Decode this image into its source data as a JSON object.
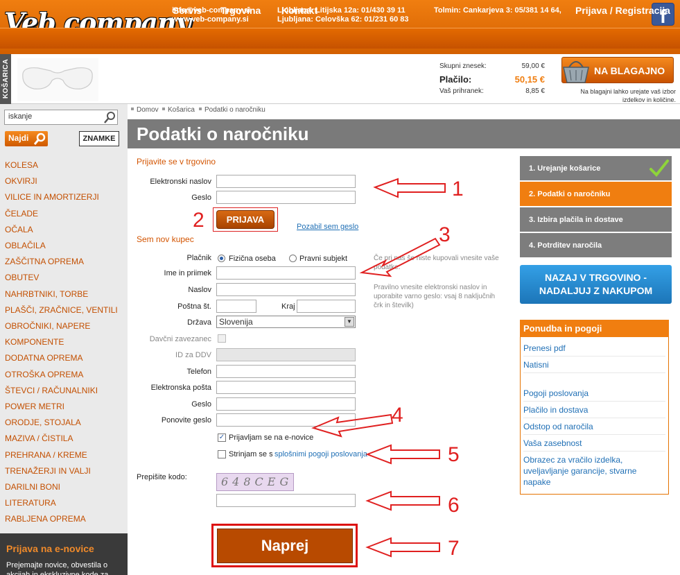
{
  "header": {
    "logo": "Veb company",
    "email": "info@veb-company.si",
    "web": "www.veb-company.si",
    "address1": "Ljubljana: Litijska 12a: 01/430 39 11",
    "address2": "Ljubljana: Celovška 62: 01/231 60 83",
    "address3": "Tolmin: Cankarjeva 3: 05/381 14 64,",
    "facebook": "f",
    "nav": [
      "Servis",
      "Trgovina",
      "Kontakt"
    ],
    "login": "Prijava / Registracija"
  },
  "cart": {
    "tab_label": "KOŠARICA",
    "total_label": "Skupni znesek:",
    "total_value": "59,00 €",
    "pay_label": "Plačilo:",
    "pay_value": "50,15 €",
    "saving_label": "Vaš prihranek:",
    "saving_value": "8,85 €",
    "checkout_label": "NA BLAGAJNO",
    "checkout_note": "Na blagajni lahko urejate vaš izbor izdelkov in količine."
  },
  "sidebar": {
    "search_value": "iskanje",
    "find_label": "Najdi",
    "brands_label": "ZNAMKE",
    "categories": [
      "KOLESA",
      "OKVIRJI",
      "VILICE IN AMORTIZERJI",
      "ČELADE",
      "OČALA",
      "OBLAČILA",
      "ZAŠČITNA OPREMA",
      "OBUTEV",
      "NAHRBTNIKI, TORBE",
      "PLAŠČI, ZRAČNICE, VENTILI",
      "OBROČNIKI, NAPERE",
      "KOMPONENTE",
      "DODATNA OPREMA",
      "OTROŠKA OPREMA",
      "ŠTEVCI / RAČUNALNIKI",
      "POWER METRI",
      "ORODJE, STOJALA",
      "MAZIVA / ČISTILA",
      "PREHRANA / KREME",
      "TRENAŽERJI IN VALJI",
      "DARILNI BONI",
      "LITERATURA",
      "RABLJENA OPREMA"
    ],
    "newsletter_title": "Prijava na e-novice",
    "newsletter_text": "Prejemajte novice, obvestila o akcijah in ekskluzivne kode za"
  },
  "breadcrumb": [
    "Domov",
    "Košarica",
    "Podatki o naročniku"
  ],
  "page_title": "Podatki o naročniku",
  "login_form": {
    "heading": "Prijavite se v trgovino",
    "email_label": "Elektronski naslov",
    "password_label": "Geslo",
    "submit_label": "PRIJAVA",
    "forgot_label": "Pozabil sem geslo"
  },
  "register_form": {
    "heading": "Sem nov kupec",
    "payer_label": "Plačnik",
    "payer_options": [
      "Fizična oseba",
      "Pravni subjekt"
    ],
    "name_label": "Ime in priimek",
    "address_label": "Naslov",
    "postcode_label": "Poštna št.",
    "city_label": "Kraj",
    "country_label": "Država",
    "country_value": "Slovenija",
    "tax_label": "Davčni zavezanec",
    "vat_label": "ID za DDV",
    "phone_label": "Telefon",
    "email_label": "Elektronska pošta",
    "password_label": "Geslo",
    "password2_label": "Ponovite geslo",
    "newsletter_label": "Prijavljam se na e-novice",
    "terms_prefix": "Strinjam se s",
    "terms_link": "splošnimi pogoji poslovanja",
    "captcha_label": "Prepišite kodo:",
    "captcha_text": "648CEG",
    "next_label": "Naprej",
    "help1": "Če pri nas še niste kupovali vnesite vaše podatke.",
    "help2": "Pravilno vnesite elektronski naslov in uporabite varno geslo: vsaj 8 naključnih črk in številk)"
  },
  "steps": [
    "1. Urejanje košarice",
    "2. Podatki o naročniku",
    "3. Izbira plačila in dostave",
    "4. Potrditev naročila"
  ],
  "back_button": "NAZAJ V TRGOVINO - NADALJUJ Z NAKUPOM",
  "offer": {
    "title": "Ponudba in pogoji",
    "links": [
      "Prenesi pdf",
      "Natisni",
      "Pogoji poslovanja",
      "Plačilo in dostava",
      "Odstop od naročila",
      "Vaša zasebnost",
      "Obrazec za vračilo izdelka, uveljavljanje garancije, stvarne napake"
    ]
  },
  "annotations": [
    "1",
    "2",
    "3",
    "4",
    "5",
    "6",
    "7"
  ],
  "colors": {
    "orange": "#f07e10",
    "dark_orange": "#b84a00",
    "blue": "#1f6fb5",
    "annotation_red": "#e02020"
  }
}
